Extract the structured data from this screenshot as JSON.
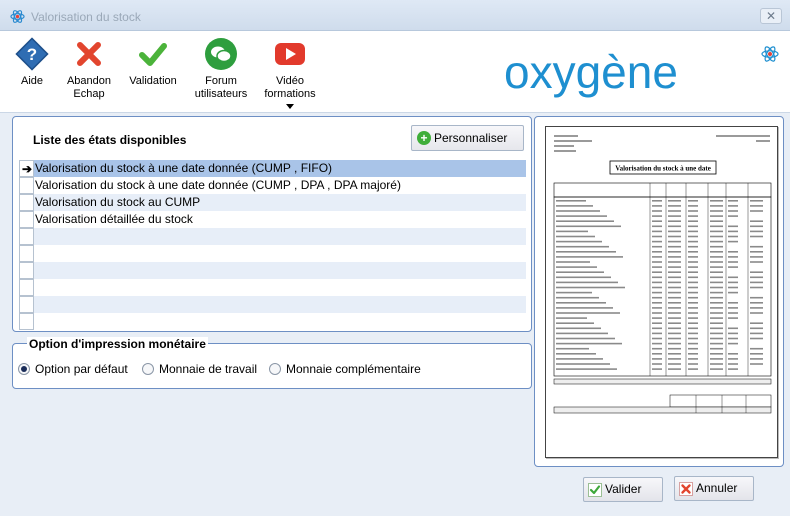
{
  "window": {
    "title": "Valorisation du stock",
    "close_label": "✕"
  },
  "toolbar": {
    "aide": "Aide",
    "abandon": "Abandon\nEchap",
    "validation": "Validation",
    "forum": "Forum\nutilisateurs",
    "video": "Vidéo\nformations"
  },
  "logo": {
    "text": "oxygène",
    "color": "#1e8fd0"
  },
  "states": {
    "heading": "Liste des états disponibles",
    "customize_label": "Personnaliser",
    "items": [
      "Valorisation du stock à une date donnée (CUMP , FIFO)",
      "Valorisation du stock à une date donnée (CUMP , DPA , DPA majoré)",
      "Valorisation du stock au CUMP",
      "Valorisation détaillée du stock",
      "",
      "",
      "",
      "",
      "",
      ""
    ],
    "selected_index": 0
  },
  "print_options": {
    "legend": "Option d'impression monétaire",
    "options": [
      "Option par défaut",
      "Monnaie de travail",
      "Monnaie complémentaire"
    ],
    "selected_index": 0
  },
  "preview": {
    "report_title": "Valorisation du stock à une date"
  },
  "buttons": {
    "valider": "Valider",
    "annuler": "Annuler"
  },
  "colors": {
    "accent_border": "#6d8fc4",
    "selected_row": "#a9c4e8",
    "alt_row": "#e7eef8"
  }
}
